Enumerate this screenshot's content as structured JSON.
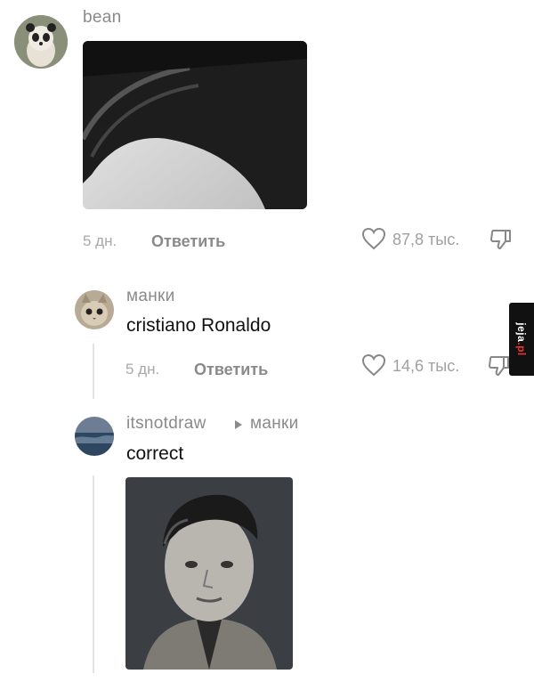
{
  "comments": [
    {
      "username": "bean",
      "avatar_icon": "panda-avatar-icon",
      "image_desc_icon": "hair-photo-icon",
      "time": "5 дн.",
      "reply_label": "Ответить",
      "likes": "87,8 тыс."
    },
    {
      "username": "манки",
      "avatar_icon": "cat-avatar-icon",
      "text": "cristiano Ronaldo",
      "time": "5 дн.",
      "reply_label": "Ответить",
      "likes": "14,6 тыс."
    },
    {
      "username": "itsnotdraw",
      "reply_to": "манки",
      "avatar_icon": "sea-avatar-icon",
      "text": "correct",
      "image_icon": "portrait-photo-icon"
    }
  ],
  "watermark": {
    "brand": "jeja",
    "tld": ".pl"
  },
  "colors": {
    "muted": "#8a8a8a",
    "text": "#111111",
    "line": "#e3e3e3"
  }
}
